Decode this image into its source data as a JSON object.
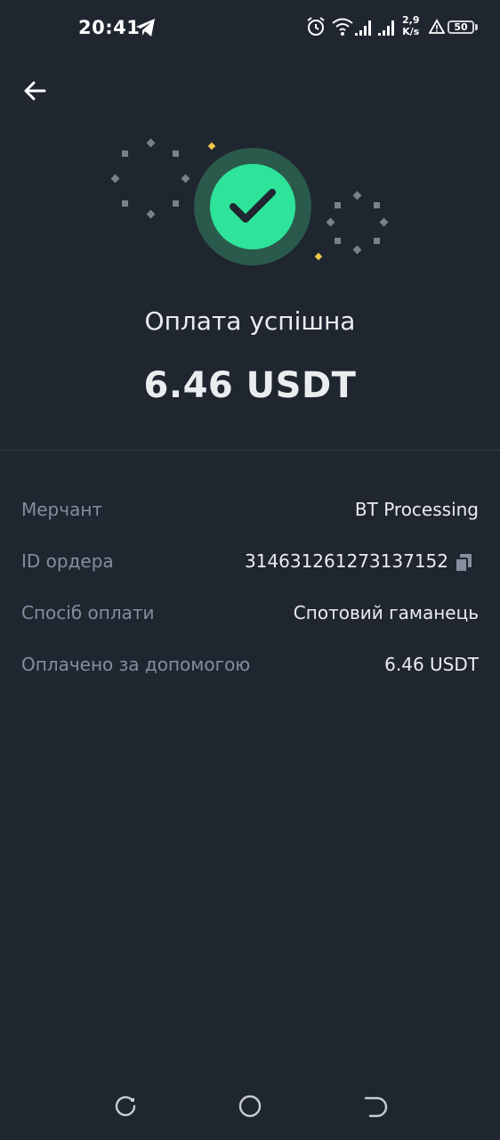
{
  "status_bar": {
    "time": "20:41",
    "net_speed_value": "2,9",
    "net_speed_unit": "K/s",
    "battery": "50"
  },
  "header": {
    "back_icon": "arrow-left-icon"
  },
  "hero": {
    "icon": "check-icon",
    "accent": "#2ee49a"
  },
  "title": "Оплата успішна",
  "amount": "6.46 USDT",
  "details": [
    {
      "label": "Мерчант",
      "value": "BT Processing"
    },
    {
      "label": "ID ордера",
      "value": "314631261273137152"
    },
    {
      "label": "Спосіб оплати",
      "value": "Спотовий гаманець"
    },
    {
      "label": "Оплачено за допомогою",
      "value": "6.46 USDT"
    }
  ],
  "colors": {
    "background": "#1f2630",
    "text_primary": "#eaecef",
    "text_secondary": "#848e9c"
  }
}
